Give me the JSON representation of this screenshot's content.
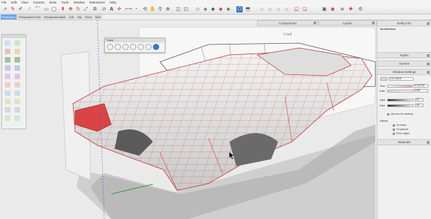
{
  "menubar": {
    "items": [
      "File",
      "Edit",
      "View",
      "Camera",
      "Draw",
      "Tools",
      "Window",
      "Extensions",
      "Help"
    ]
  },
  "toolbar": {
    "icons": [
      "select-tool",
      "eraser-tool",
      "paint-bucket",
      "line-tool",
      "arc-tool",
      "rectangle-tool",
      "circle-tool",
      "polygon-tool",
      "push-pull-tool",
      "move-tool",
      "rotate-tool",
      "scale-tool",
      "offset-tool",
      "tape-measure-tool",
      "text-tool",
      "axes-tool",
      "dimension-tool",
      "protractor-tool",
      "orbit-tool",
      "pan-tool",
      "zoom-tool",
      "zoom-extents-tool",
      "x-ray",
      "back-edges",
      "wireframe",
      "hidden-line",
      "shaded",
      "shaded-textures",
      "monochrome",
      "iso-view",
      "top-view",
      "front-view",
      "right-view",
      "back-view",
      "left-view",
      "section-plane",
      "3d-warehouse",
      "extension-warehouse",
      "layout"
    ]
  },
  "scenes": {
    "tabs": [
      "Production",
      "Perspective Front",
      "Perspective Back",
      "Left",
      "Top",
      "Front",
      "Side"
    ],
    "active_index": 0
  },
  "floating_toolbar": {
    "title": "Trace"
  },
  "trays": {
    "components": "Components",
    "layers": "Layers",
    "entity_info": "Entity Info",
    "styles": "Styles",
    "scenes": "Scenes",
    "shadows": "Shadow Settings",
    "materials": "Materials"
  },
  "entity_info": {
    "selection": "No Selection"
  },
  "shadows": {
    "utc_label": "UTC-05:00",
    "time_label": "Time",
    "time_value": "01:30 PM",
    "date_label": "Date",
    "date_value": "11/08",
    "light_label": "Light",
    "light_value": "80",
    "dark_label": "Dark",
    "dark_value": "45",
    "use_sun_label": "Use sun for shading",
    "display_label": "Display",
    "on_faces_label": "On faces",
    "on_ground_label": "On ground",
    "from_edges_label": "From edges"
  },
  "background_image": {
    "ghost_text": "Cool"
  },
  "colors": {
    "accent": "#6aa6e8",
    "model_fill": "#e6e6e6",
    "model_edges": "#d64a4a",
    "model_red": "#d94444"
  }
}
